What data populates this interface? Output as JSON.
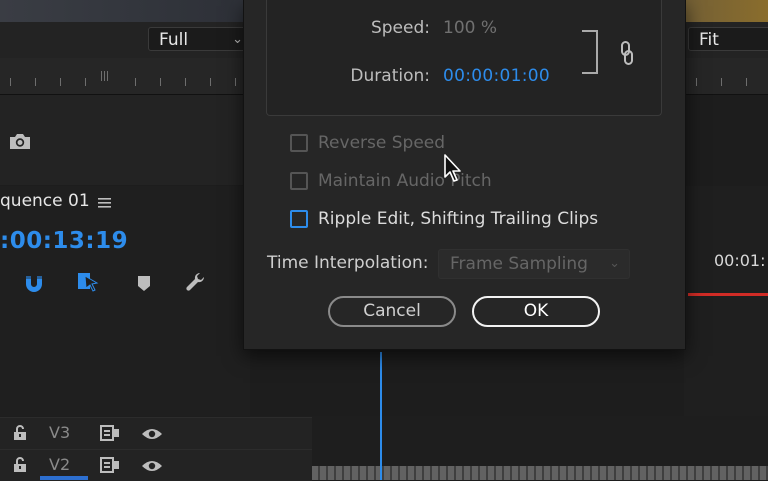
{
  "monitor": {
    "zoom_select": "Full",
    "fit_select": "Fit"
  },
  "sequence": {
    "title": "quence 01",
    "timecode": ":00:13:19",
    "right_timecode": "00:01:"
  },
  "tracks": [
    {
      "label": "V3"
    },
    {
      "label": "V2"
    }
  ],
  "dialog": {
    "speed_label": "Speed:",
    "speed_value": "100 %",
    "duration_label": "Duration:",
    "duration_value": "00:00:01:00",
    "reverse_speed": {
      "label": "Reverse Speed",
      "checked": false,
      "enabled": false
    },
    "maintain_audio_pitch": {
      "label": "Maintain Audio Pitch",
      "checked": false,
      "enabled": false
    },
    "ripple_edit": {
      "label": "Ripple Edit, Shifting Trailing Clips",
      "checked": false,
      "enabled": true
    },
    "time_interpolation_label": "Time Interpolation:",
    "time_interpolation_value": "Frame Sampling",
    "cancel_label": "Cancel",
    "ok_label": "OK"
  },
  "colors": {
    "accent_blue": "#2d8ceb",
    "playhead_red": "#d12c26",
    "panel_bg": "#262626"
  }
}
